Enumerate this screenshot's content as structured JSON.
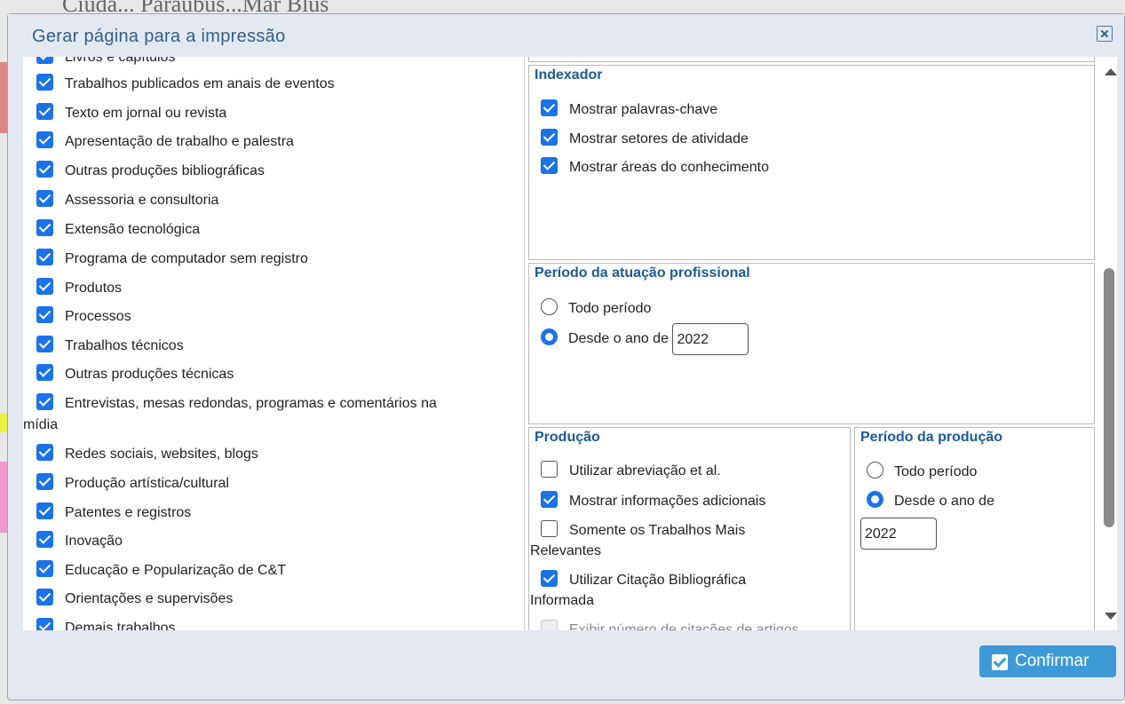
{
  "background": {
    "page_title": "Ciuda... Paraúbus...Mar Blus"
  },
  "dialog": {
    "title": "Gerar página para a impressão",
    "confirm_label": "Confirmar"
  },
  "left_list": {
    "items": [
      {
        "label": "Livros e capítulos",
        "checked": true
      },
      {
        "label": "Trabalhos publicados em anais de eventos",
        "checked": true
      },
      {
        "label": "Texto em jornal ou revista",
        "checked": true
      },
      {
        "label": "Apresentação de trabalho e palestra",
        "checked": true
      },
      {
        "label": "Outras produções bibliográficas",
        "checked": true
      },
      {
        "label": "Assessoria e consultoria",
        "checked": true
      },
      {
        "label": "Extensão tecnológica",
        "checked": true
      },
      {
        "label": "Programa de computador sem registro",
        "checked": true
      },
      {
        "label": "Produtos",
        "checked": true
      },
      {
        "label": "Processos",
        "checked": true
      },
      {
        "label": "Trabalhos técnicos",
        "checked": true
      },
      {
        "label": "Outras produções técnicas",
        "checked": true
      },
      {
        "label": "Entrevistas, mesas redondas, programas e comentários na",
        "label2": "mídia",
        "checked": true
      },
      {
        "label": "Redes sociais, websites, blogs",
        "checked": true
      },
      {
        "label": "Produção artística/cultural",
        "checked": true
      },
      {
        "label": "Patentes e registros",
        "checked": true
      },
      {
        "label": "Inovação",
        "checked": true
      },
      {
        "label": "Educação e Popularização de C&T",
        "checked": true
      },
      {
        "label": "Orientações e supervisões",
        "checked": true
      },
      {
        "label": "Demais trabalhos",
        "checked": true
      }
    ]
  },
  "indexador": {
    "title": "Indexador",
    "options": [
      {
        "label": "Mostrar palavras-chave",
        "checked": true
      },
      {
        "label": "Mostrar setores de atividade",
        "checked": true
      },
      {
        "label": "Mostrar áreas do conhecimento",
        "checked": true
      }
    ]
  },
  "periodo_atuacao": {
    "title": "Período da atuação profissional",
    "option_all": "Todo período",
    "option_since": "Desde o ano de",
    "selected": "since",
    "year": "2022"
  },
  "producao": {
    "title": "Produção",
    "options": [
      {
        "label": "Utilizar abreviação et al.",
        "checked": false
      },
      {
        "label": "Mostrar informações adicionais",
        "checked": true
      },
      {
        "label": "Somente os Trabalhos Mais",
        "label2": "Relevantes",
        "checked": false
      },
      {
        "label": "Utilizar Citação Bibliográfica",
        "label2": "Informada",
        "checked": true
      },
      {
        "label": "Exibir número de citações de artigos",
        "checked": false,
        "disabled": true
      }
    ]
  },
  "periodo_producao": {
    "title": "Período da produção",
    "option_all": "Todo período",
    "option_since": "Desde o ano de",
    "selected": "since",
    "year": "2022"
  },
  "colors": {
    "accent": "#1a73e8",
    "title": "#1e5a96",
    "button": "#3e9ad6"
  }
}
